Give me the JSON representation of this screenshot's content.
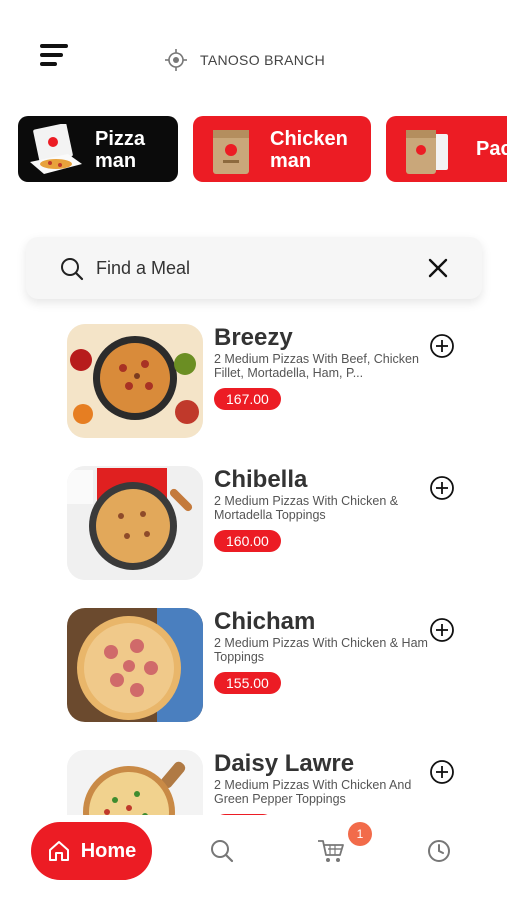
{
  "header": {
    "branch_label": "TANOSO BRANCH",
    "menu_icon": "hamburger-icon",
    "branch_icon": "location-target-icon"
  },
  "brands": [
    {
      "label_line1": "Pizza",
      "label_line2": "man",
      "background": "#0b0b0b",
      "selected": true
    },
    {
      "label_line1": "Chicken",
      "label_line2": "man",
      "background": "#ec1c24",
      "selected": false
    },
    {
      "label_line1": "Pac",
      "label_line2": "",
      "background": "#ec1c24",
      "selected": false
    }
  ],
  "search": {
    "placeholder": "Find a Meal",
    "value": "",
    "search_icon": "search-icon",
    "clear_icon": "close-icon"
  },
  "meals": [
    {
      "name": "Breezy",
      "description": "2 Medium Pizzas With Beef, Chicken Fillet, Mortadella, Ham, P...",
      "price": "167.00"
    },
    {
      "name": "Chibella",
      "description": "2 Medium Pizzas With Chicken & Mortadella Toppings",
      "price": "160.00"
    },
    {
      "name": "Chicham",
      "description": "2 Medium Pizzas With Chicken & Ham Toppings",
      "price": "155.00"
    },
    {
      "name": "Daisy Lawre",
      "description": "2 Medium Pizzas With Chicken And Green Pepper Toppings",
      "price": ""
    }
  ],
  "bottom_nav": {
    "home_label": "Home",
    "cart_count": "1",
    "icons": [
      "home-icon",
      "search-icon",
      "cart-icon",
      "history-icon"
    ]
  },
  "colors": {
    "accent": "#ec1c24",
    "badge": "#f26b4a",
    "dark": "#0b0b0b"
  }
}
